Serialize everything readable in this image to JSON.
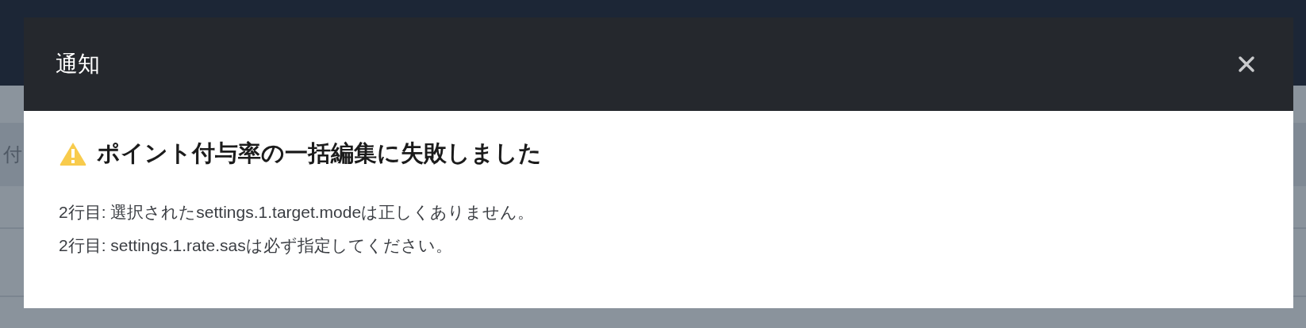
{
  "background": {
    "table_cell": "付"
  },
  "dialog": {
    "title": "通知",
    "heading": "ポイント付与率の一括編集に失敗しました",
    "messages": [
      "2行目: 選択されたsettings.1.target.modeは正しくありません。",
      "2行目: settings.1.rate.sasは必ず指定してください。"
    ]
  }
}
